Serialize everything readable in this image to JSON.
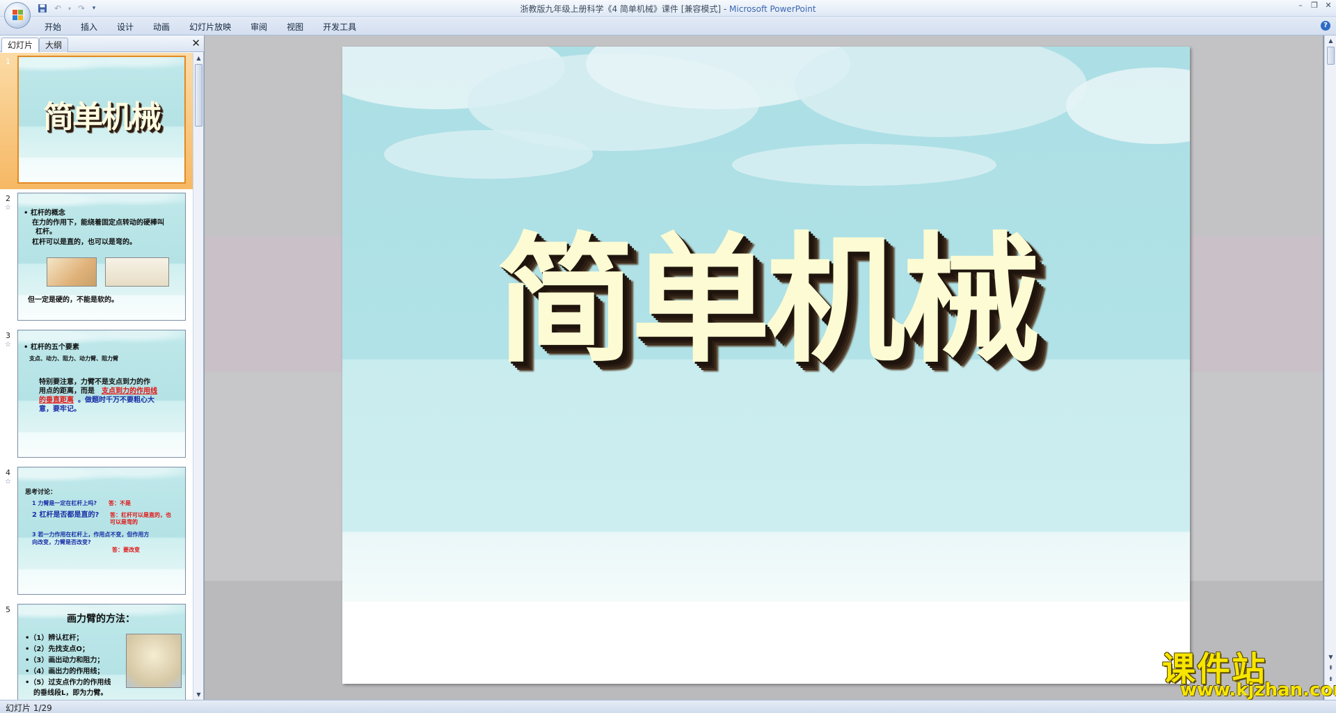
{
  "window": {
    "title": "浙教版九年级上册科学《4 简单机械》课件 [兼容模式] - ",
    "app_name": "Microsoft PowerPoint"
  },
  "ribbon": {
    "tabs": [
      "开始",
      "插入",
      "设计",
      "动画",
      "幻灯片放映",
      "审阅",
      "视图",
      "开发工具"
    ]
  },
  "panel": {
    "tab_slides": "幻灯片",
    "tab_outline": "大纲"
  },
  "slides": [
    {
      "number": "1",
      "title": "简单机械"
    },
    {
      "number": "2",
      "bullet": "• 杠杆的概念",
      "line1": "在力的作用下，能绕着固定点转动的硬棒叫",
      "line2": "杠杆。",
      "line3": "杠杆可以是直的，也可以是弯的。",
      "line4": "但一定是硬的，不能是软的。"
    },
    {
      "number": "3",
      "bullet": "• 杠杆的五个要素",
      "line1": "支点、动力、阻力、动力臂、阻力臂",
      "line2": "特别要注意，力臂不是支点到力的作",
      "line3a": "用点的距离，而是",
      "line3b": "支点到力的作用线",
      "line4a": "的垂直距离",
      "line4b": "。做题时千万不要粗心大",
      "line5": "意，要牢记。"
    },
    {
      "number": "4",
      "heading": "思考讨论：",
      "q1": "1 力臂是一定在杠杆上吗?",
      "a1": "答：不是",
      "q2": "2 杠杆是否都是直的?",
      "a2a": "答：杠杆可以是直的，也",
      "a2b": "可以是弯的",
      "q3a": "3 若一力作用在杠杆上，作用点不变，但作用方",
      "q3b": "向改变，力臂是否改变?",
      "a3": "答：要改变"
    },
    {
      "number": "5",
      "title": "画力臂的方法：",
      "items": [
        "•（1）辨认杠杆；",
        "•（2）先找支点O；",
        "•（3）画出动力和阻力；",
        "•（4）画出力的作用线；",
        "•（5）过支点作力的作用线",
        "的垂线段L，即为力臂。"
      ]
    }
  ],
  "main_slide": {
    "title": "简单机械"
  },
  "watermark": {
    "brand": "课件站",
    "url": "www.kjzhan.com"
  },
  "status": {
    "slide_counter": "幻灯片 1/29"
  }
}
